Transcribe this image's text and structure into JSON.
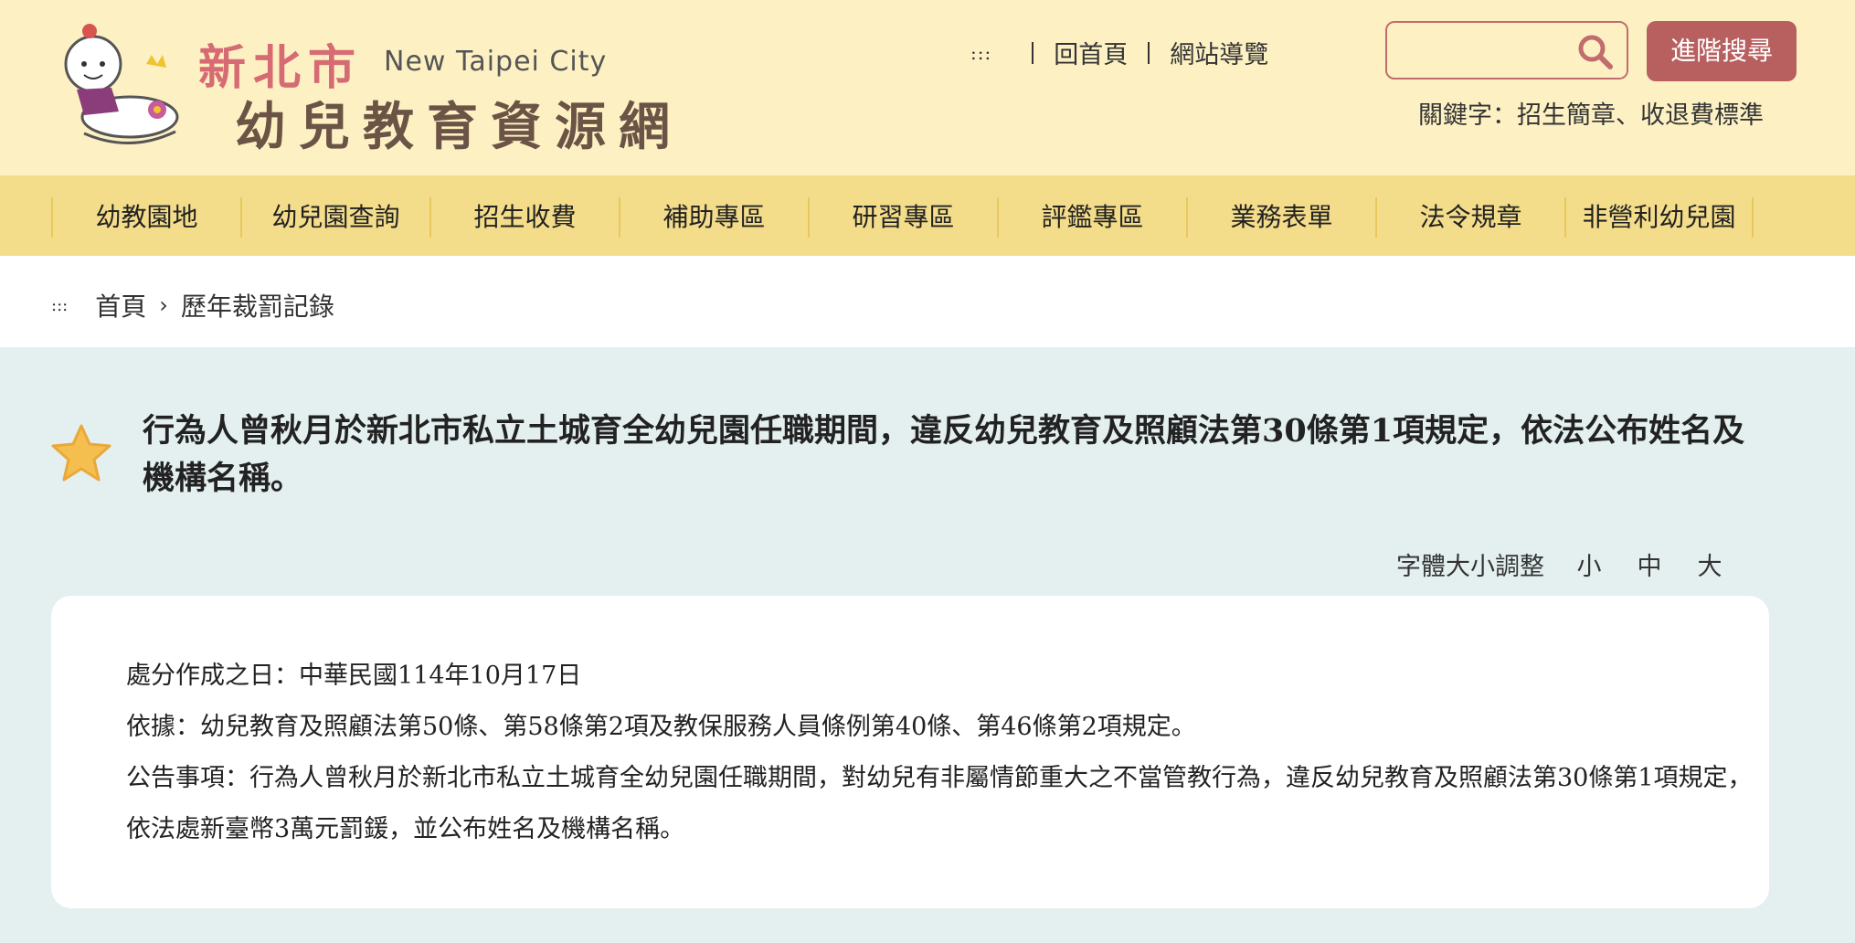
{
  "header": {
    "logo_title": "新北市",
    "logo_english": "New Taipei City",
    "logo_subtitle": "幼兒教育資源網",
    "accesskey": ":::",
    "home_link": "回首頁",
    "sitemap_link": "網站導覽",
    "search_placeholder": "",
    "advanced_search_label": "進階搜尋",
    "keywords_text": "關鍵字：招生簡章、收退費標準"
  },
  "nav": {
    "items": [
      {
        "label": "幼教園地"
      },
      {
        "label": "幼兒園查詢"
      },
      {
        "label": "招生收費"
      },
      {
        "label": "補助專區"
      },
      {
        "label": "研習專區"
      },
      {
        "label": "評鑑專區"
      },
      {
        "label": "業務表單"
      },
      {
        "label": "法令規章"
      },
      {
        "label": "非營利幼兒園"
      }
    ]
  },
  "breadcrumb": {
    "accesskey": ":::",
    "home": "首頁",
    "current": "歷年裁罰記錄"
  },
  "article": {
    "title": "行為人曾秋月於新北市私立土城育全幼兒園任職期間，違反幼兒教育及照顧法第30條第1項規定，依法公布姓名及機構名稱。",
    "font_size_label": "字體大小調整",
    "font_small": "小",
    "font_medium": "中",
    "font_large": "大",
    "date_line": "處分作成之日：中華民國114年10月17日",
    "basis_line": "依據：幼兒教育及照顧法第50條、第58條第2項及教保服務人員條例第40條、第46條第2項規定。",
    "notice_line": "公告事項：行為人曾秋月於新北市私立土城育全幼兒園任職期間，對幼兒有非屬情節重大之不當管教行為，違反幼兒教育及照顧法第30條第1項規定，依法處新臺幣3萬元罰鍰，並公布姓名及機構名稱。"
  },
  "colors": {
    "header_bg": "#fdf1c4",
    "nav_bg": "#f4dd8a",
    "accent": "#b85f5f",
    "content_bg": "#e4efef"
  },
  "icons": [
    "search-icon",
    "star-icon",
    "chevron-right-icon",
    "mascot-logo"
  ]
}
